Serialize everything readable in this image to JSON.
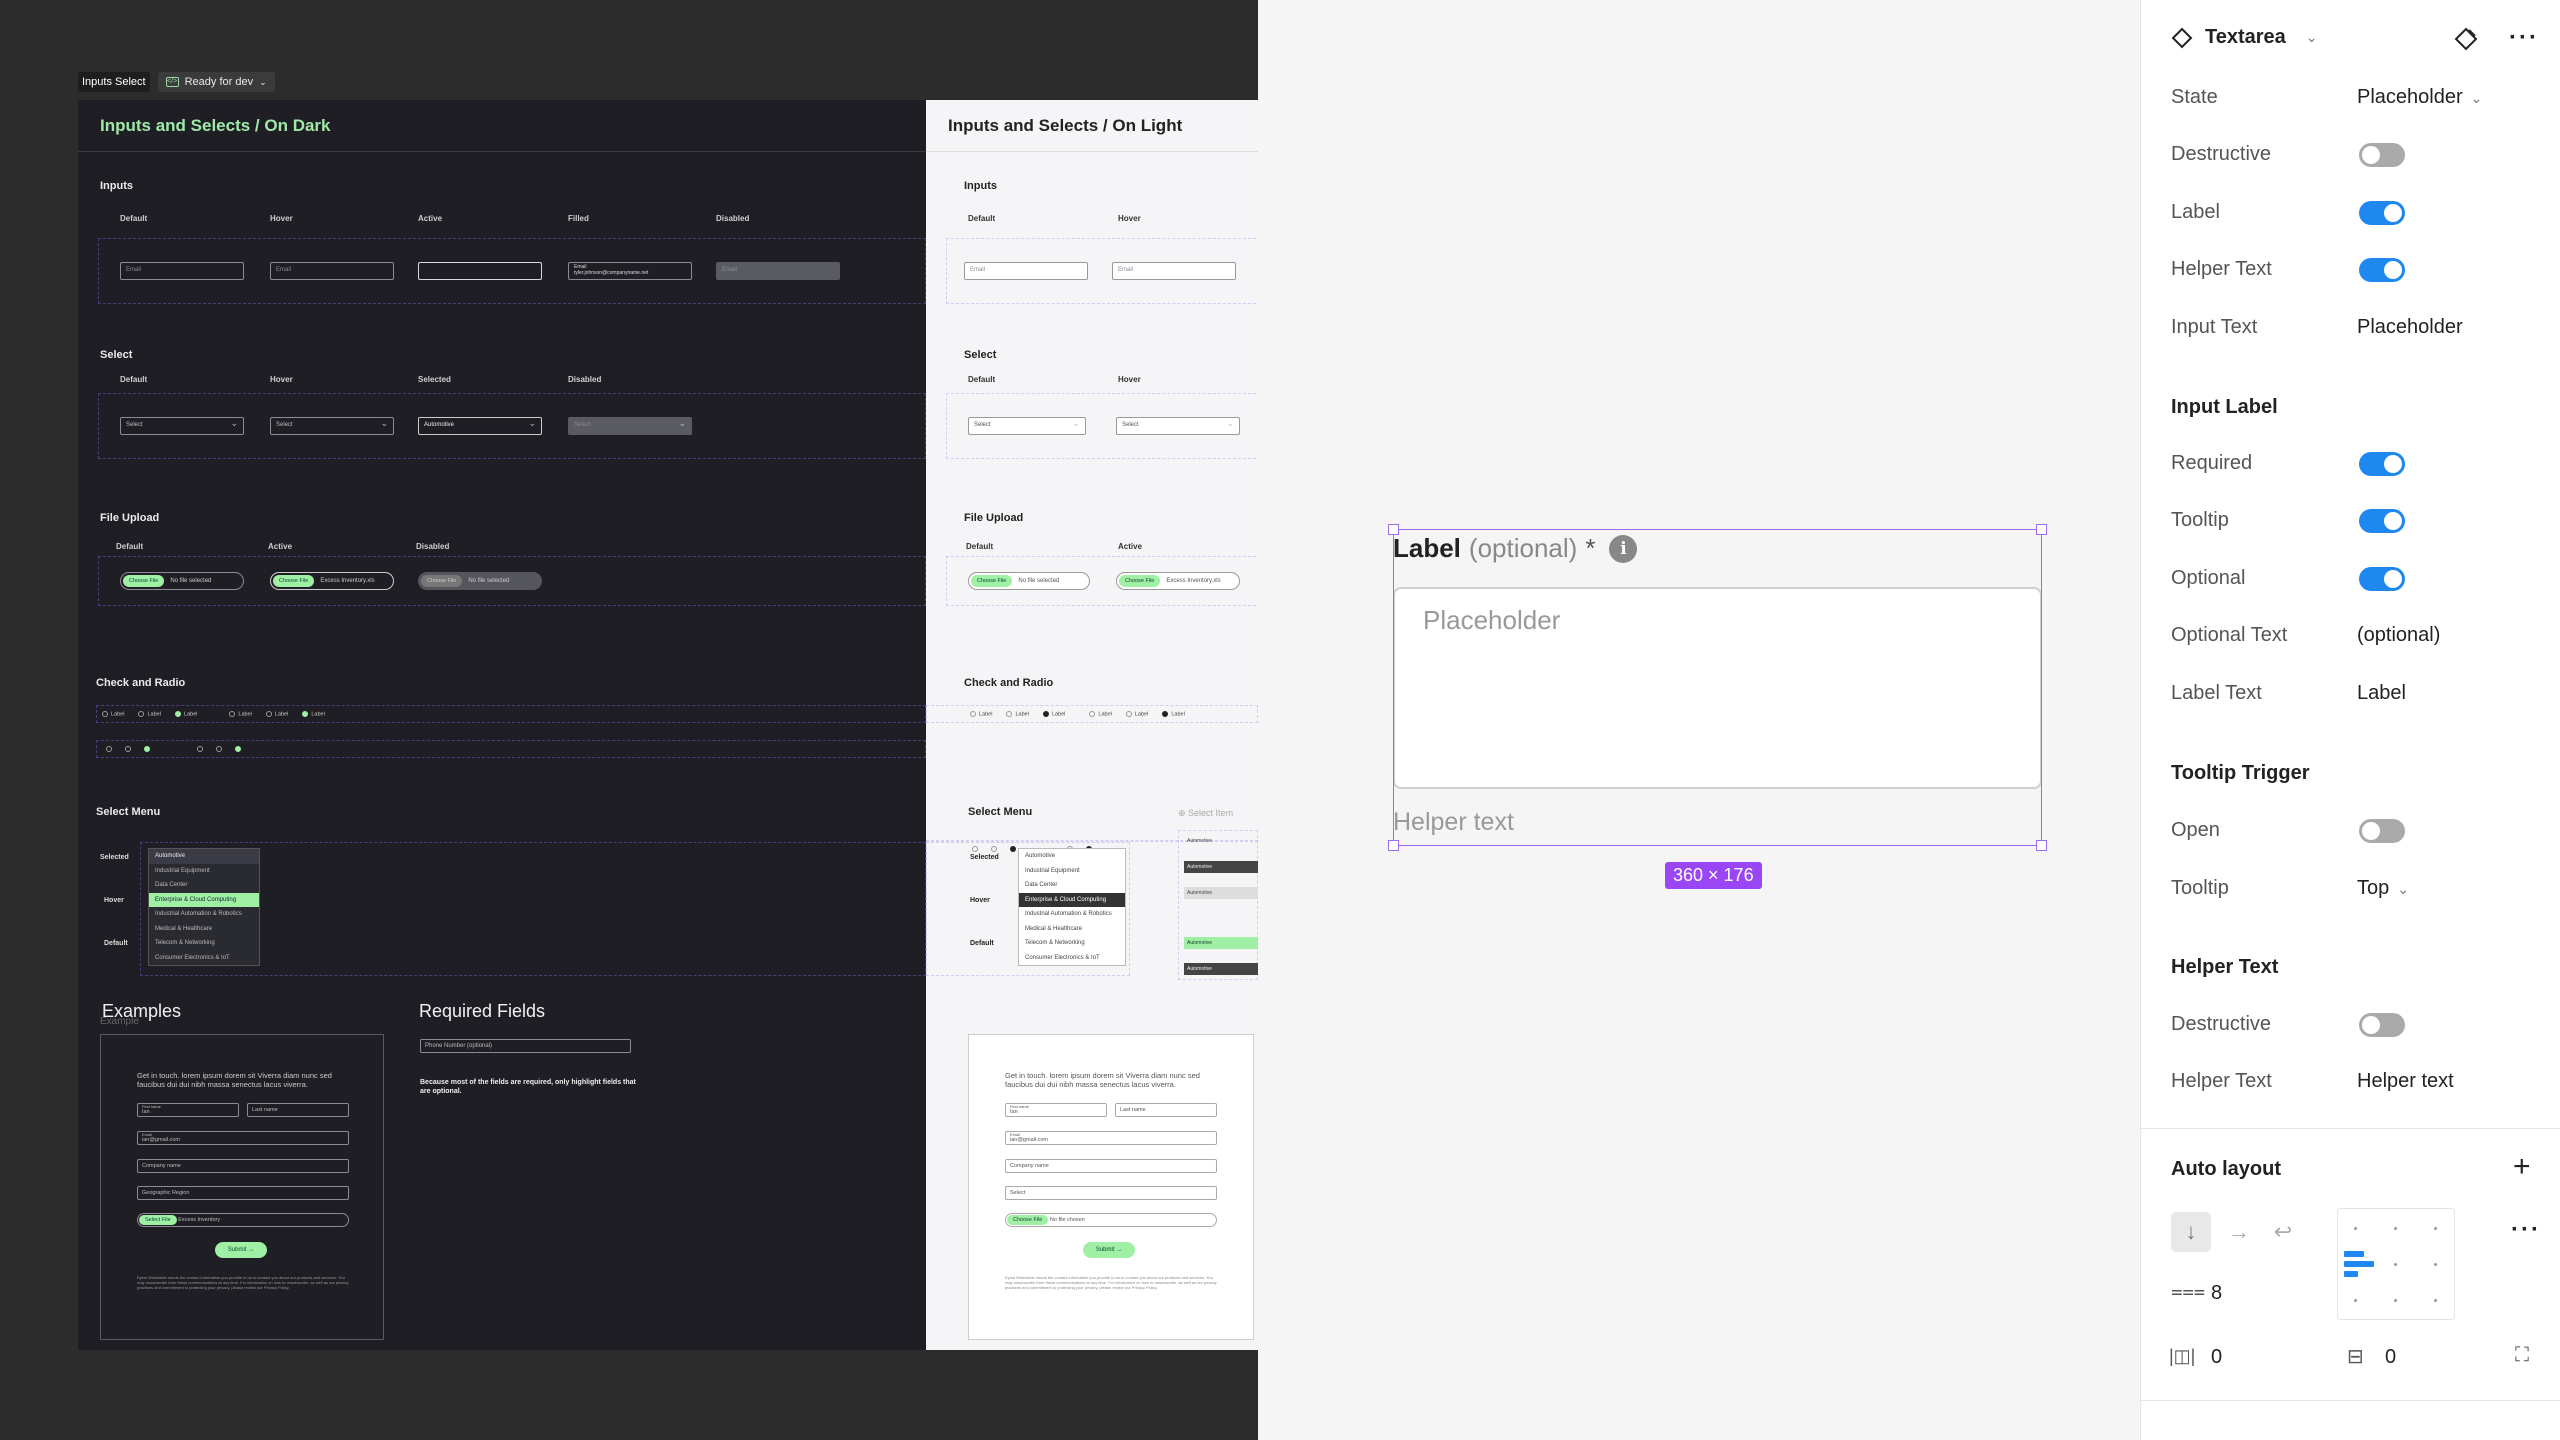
{
  "frame_tag": {
    "name": "Inputs Select",
    "status": "Ready for dev"
  },
  "dark_frame": {
    "title": "Inputs and Selects / On Dark",
    "inputs": {
      "title": "Inputs",
      "cols": [
        "Default",
        "Hover",
        "Active",
        "Filled",
        "Disabled"
      ],
      "placeholder": "Email",
      "filled_label": "Email",
      "filled_value": "tyler.johnson@companyname.net"
    },
    "select": {
      "title": "Select",
      "cols": [
        "Default",
        "Hover",
        "Selected",
        "Disabled"
      ],
      "values": [
        "Select",
        "Select",
        "Automotive",
        "Select"
      ]
    },
    "upload": {
      "title": "File Upload",
      "cols": [
        "Default",
        "Active",
        "Disabled"
      ],
      "chip": "Choose File",
      "texts": [
        "No file selected",
        "Excess Inventory.xls",
        "No file selected"
      ]
    },
    "check": {
      "title": "Check and Radio",
      "label": "Label"
    },
    "menu": {
      "title": "Select Menu",
      "rows": [
        "Selected",
        "Hover",
        "Default"
      ],
      "items": [
        "Automotive",
        "Industrial Equipment",
        "Data Center",
        "Enterprise & Cloud Computing",
        "Industrial Automation & Robotics",
        "Medical & Healthcare",
        "Telecom & Networking",
        "Consumer Electronics & IoT"
      ]
    },
    "examples": {
      "title": "Examples",
      "ghost": "Example",
      "intro": "Get in touch. lorem ipsum dorem sit Viverra diam nunc sed faucibus dui dui nibh massa senectus lacus viverra.",
      "first_label": "First name",
      "first": "Ian",
      "last": "Last name",
      "email_label": "Email",
      "email": "ian@gmail.com",
      "company": "Company name",
      "region": "Geographic Region",
      "file_chip": "Select File",
      "file": "Excess Inventory",
      "submit": "Submit",
      "footer": "Eyest Worldwide needs the contact information you provide to us to contact you about our products and services. You may unsubscribe from these communications at any time. For information on how to unsubscribe, as well as our privacy practices and commitment to protecting your privacy, please review our Privacy Policy."
    },
    "required": {
      "title": "Required Fields",
      "field": "Phone Number (optional)",
      "note": "Because most of the fields are required, only highlight fields that are optional."
    }
  },
  "light_frame": {
    "title": "Inputs and Selects / On Light",
    "inputs_title": "Inputs",
    "cols": [
      "Default",
      "Hover"
    ],
    "select_title": "Select",
    "select_value": "Select",
    "upload_title": "File Upload",
    "upload_cols": [
      "Default",
      "Active"
    ],
    "check_title": "Check and Radio",
    "menu_title": "Select Menu",
    "select_item": "Select Item",
    "examples": {
      "first_label": "First name",
      "first": "Ian",
      "last": "Last name",
      "email_label": "Email",
      "email": "ian@gmail.com",
      "company": "Company name",
      "region": "Select",
      "file_chip": "Choose File",
      "file": "No file chosen",
      "submit": "Submit"
    }
  },
  "component": {
    "label": "Label",
    "optional": "(optional)",
    "required_mark": "*",
    "placeholder": "Placeholder",
    "helper": "Helper text",
    "dimensions": "360 × 176"
  },
  "panel": {
    "component_name": "Textarea",
    "props": [
      {
        "name": "State",
        "value": "Placeholder"
      },
      {
        "name": "Destructive",
        "toggle": false
      },
      {
        "name": "Label",
        "toggle": true
      },
      {
        "name": "Helper Text",
        "toggle": true
      },
      {
        "name": "Input Text",
        "value": "Placeholder"
      }
    ],
    "input_label": {
      "title": "Input Label",
      "required": "Required",
      "tooltip": "Tooltip",
      "optional": "Optional",
      "optional_text": "Optional Text",
      "optional_text_value": "(optional)",
      "label_text": "Label Text",
      "label_text_value": "Label"
    },
    "tooltip_trigger": {
      "title": "Tooltip Trigger",
      "open": "Open",
      "tooltip": "Tooltip",
      "tooltip_value": "Top"
    },
    "helper_text": {
      "title": "Helper Text",
      "destructive": "Destructive",
      "helper": "Helper Text",
      "helper_value": "Helper text"
    },
    "auto_layout": {
      "title": "Auto layout",
      "gap": "8",
      "pad_h": "0",
      "pad_v": "0"
    },
    "colors": {
      "accent": "#1e88f0",
      "selection": "#9a6cf0",
      "dark_accent": "#9fe8a8"
    }
  }
}
